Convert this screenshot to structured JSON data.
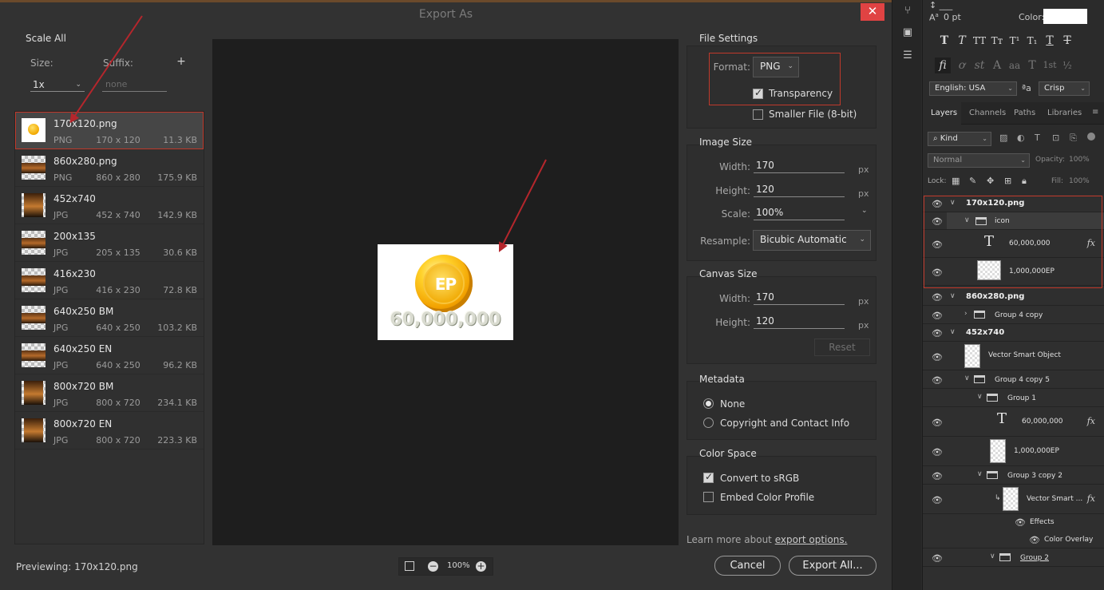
{
  "dialog": {
    "title": "Export As",
    "close_icon": "close-icon"
  },
  "scale_all": {
    "title": "Scale All",
    "size_label": "Size:",
    "suffix_label": "Suffix:",
    "add_icon": "+",
    "size_value": "1x",
    "suffix_placeholder": "none"
  },
  "assets": [
    {
      "name": "170x120.png",
      "format": "PNG",
      "dims": "170 x 120",
      "size": "11.3 KB",
      "selected": true
    },
    {
      "name": "860x280.png",
      "format": "PNG",
      "dims": "860 x 280",
      "size": "175.9 KB"
    },
    {
      "name": "452x740",
      "format": "JPG",
      "dims": "452 x 740",
      "size": "142.9 KB"
    },
    {
      "name": "200x135",
      "format": "JPG",
      "dims": "205 x 135",
      "size": "30.6 KB"
    },
    {
      "name": "416x230",
      "format": "JPG",
      "dims": "416 x 230",
      "size": "72.8 KB"
    },
    {
      "name": "640x250 BM",
      "format": "JPG",
      "dims": "640 x 250",
      "size": "103.2 KB"
    },
    {
      "name": "640x250 EN",
      "format": "JPG",
      "dims": "640 x 250",
      "size": "96.2 KB"
    },
    {
      "name": "800x720 BM",
      "format": "JPG",
      "dims": "800 x 720",
      "size": "234.1 KB"
    },
    {
      "name": "800x720 EN",
      "format": "JPG",
      "dims": "800 x 720",
      "size": "223.3 KB"
    }
  ],
  "preview": {
    "coin_text": "EP",
    "amount_text": "60,000,000",
    "previewing_label": "Previewing: 170x120.png",
    "zoom": "100%"
  },
  "file_settings": {
    "title": "File Settings",
    "format_label": "Format:",
    "format_value": "PNG",
    "transparency_label": "Transparency",
    "transparency_checked": true,
    "smaller_file_label": "Smaller File (8-bit)",
    "smaller_file_checked": false
  },
  "image_size": {
    "title": "Image Size",
    "width_label": "Width:",
    "width_value": "170",
    "height_label": "Height:",
    "height_value": "120",
    "scale_label": "Scale:",
    "scale_value": "100%",
    "resample_label": "Resample:",
    "resample_value": "Bicubic Automatic",
    "unit": "px"
  },
  "canvas_size": {
    "title": "Canvas Size",
    "width_label": "Width:",
    "width_value": "170",
    "height_label": "Height:",
    "height_value": "120",
    "unit": "px",
    "reset_label": "Reset"
  },
  "metadata": {
    "title": "Metadata",
    "none_label": "None",
    "copyright_label": "Copyright and Contact Info",
    "selected": "none"
  },
  "color_space": {
    "title": "Color Space",
    "convert_label": "Convert to sRGB",
    "convert_checked": true,
    "embed_label": "Embed Color Profile",
    "embed_checked": false
  },
  "footer": {
    "learn_more_prefix": "Learn more about ",
    "learn_more_link": "export options.",
    "cancel_label": "Cancel",
    "export_all_label": "Export All..."
  },
  "character_panel": {
    "tracking_value": "0 pt",
    "color_label": "Color:",
    "color_value": "#ffffff",
    "language_value": "English: USA",
    "aa_label": "ªa",
    "antialias_value": "Crisp"
  },
  "layers_panel": {
    "tabs": [
      "Layers",
      "Channels",
      "Paths",
      "Libraries"
    ],
    "kind_label": "Kind",
    "blend_mode": "Normal",
    "opacity_label": "Opacity:",
    "opacity_value": "100%",
    "lock_label": "Lock:",
    "fill_label": "Fill:",
    "fill_value": "100%",
    "layers": [
      {
        "name": "170x120.png",
        "type": "artboard",
        "bold": true
      },
      {
        "name": "icon",
        "type": "group",
        "selected": true
      },
      {
        "name": "60,000,000",
        "type": "text",
        "fx": true
      },
      {
        "name": "1,000,000EP",
        "type": "smart"
      },
      {
        "name": "860x280.png",
        "type": "artboard",
        "bold": true
      },
      {
        "name": "Group 4 copy",
        "type": "group"
      },
      {
        "name": "452x740",
        "type": "artboard",
        "bold": true
      },
      {
        "name": "Vector Smart Object",
        "type": "smart"
      },
      {
        "name": "Group 4 copy 5",
        "type": "group"
      },
      {
        "name": "Group 1",
        "type": "group"
      },
      {
        "name": "60,000,000",
        "type": "text",
        "fx": true
      },
      {
        "name": "1,000,000EP",
        "type": "smart"
      },
      {
        "name": "Group 3 copy 2",
        "type": "group"
      },
      {
        "name": "Vector Smart ...",
        "type": "smart",
        "fx": true
      },
      {
        "name": "Effects",
        "type": "effects"
      },
      {
        "name": "Color Overlay",
        "type": "effect"
      },
      {
        "name": "Group 2",
        "type": "group"
      }
    ]
  }
}
